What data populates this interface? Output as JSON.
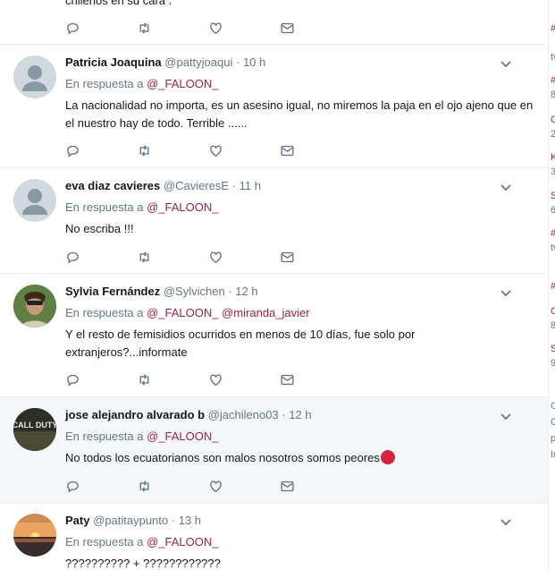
{
  "top_fragment": {
    "text": "chilenos en su cara ."
  },
  "tweets": [
    {
      "name": "Patricia Joaquina",
      "handle": "@pattyjoaqui",
      "time": "10 h",
      "reply_prefix": "En respuesta a",
      "mentions": [
        "@_FALOON_"
      ],
      "text": "La nacionalidad no importa, es un asesino igual, no miremos la paja en el ojo ajeno que en el nuestro hay de todo. Terrible ......",
      "avatar": "default"
    },
    {
      "name": "eva diaz cavieres",
      "handle": "@CavieresE",
      "time": "11 h",
      "reply_prefix": "En respuesta a",
      "mentions": [
        "@_FALOON_"
      ],
      "text": "No escriba !!!",
      "avatar": "default"
    },
    {
      "name": "Sylvia Fernández",
      "handle": "@Sylvichen",
      "time": "12 h",
      "reply_prefix": "En respuesta a",
      "mentions": [
        "@_FALOON_",
        "@miranda_javier"
      ],
      "text": "Y el resto de femisidios ocurridos en menos de 10 días, fue solo por extranjeros?...informate",
      "avatar": "photo"
    },
    {
      "name": "jose alejandro alvarado b",
      "handle": "@jachileno03",
      "time": "12 h",
      "reply_prefix": "En respuesta a",
      "mentions": [
        "@_FALOON_"
      ],
      "text": "No todos los ecuatorianos son malos nosotros somos peores",
      "avatar": "game",
      "avatar_text": "CALL DUTY",
      "emoji": "angry-face-icon"
    },
    {
      "name": "Paty",
      "handle": "@patitaypunto",
      "time": "13 h",
      "reply_prefix": "En respuesta a",
      "mentions": [
        "@_FALOON_"
      ],
      "text": "?????????? + ????????????",
      "avatar": "sunset"
    }
  ],
  "sidebar_fragments": [
    "#",
    "tv",
    "#",
    "8",
    "G",
    "2",
    "K",
    "3",
    "S",
    "6",
    "#",
    "tv",
    "#",
    "C",
    "8",
    "S",
    "9",
    "C",
    "C",
    "p",
    "Ir"
  ],
  "colors": {
    "mention": "#9c2442",
    "meta": "#657786",
    "highlight": "#f5f8fa",
    "divider": "#e6ecf0"
  }
}
